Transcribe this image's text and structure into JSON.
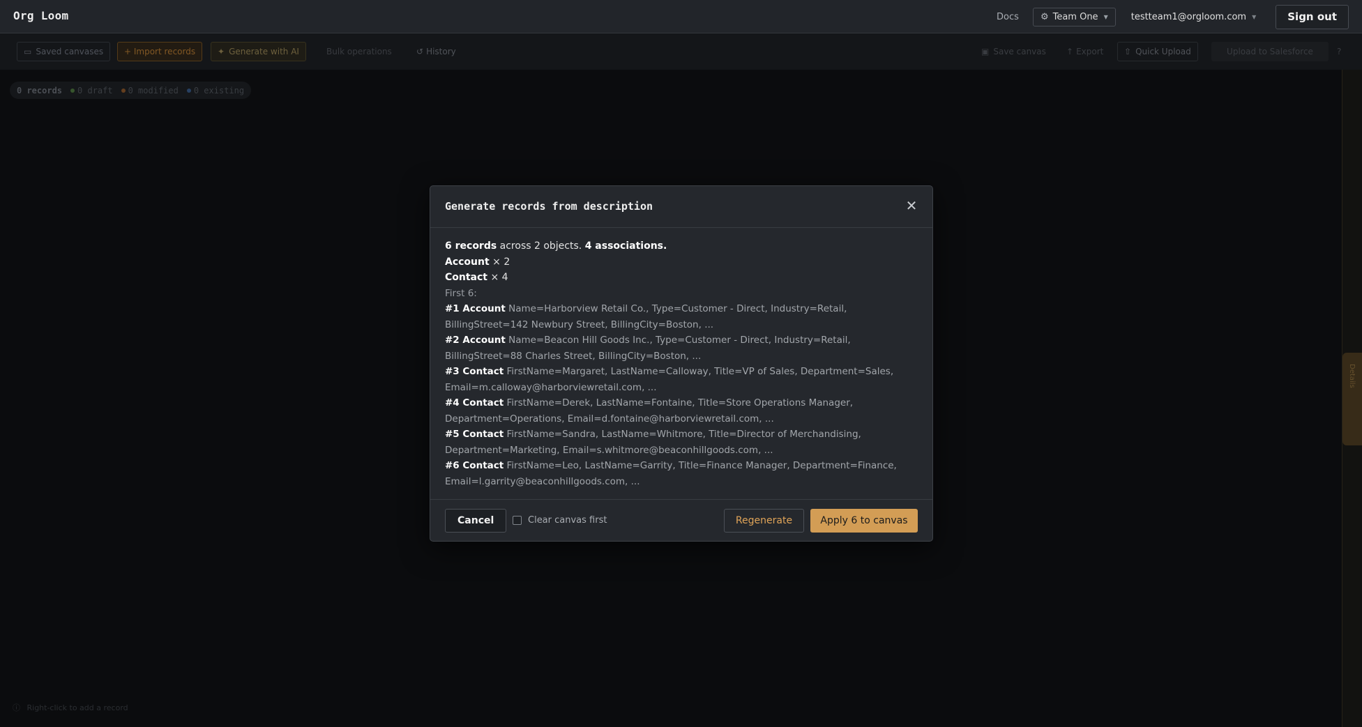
{
  "app": {
    "brand": "Org Loom"
  },
  "header": {
    "docs_label": "Docs",
    "team_label": "Team One",
    "user_email": "testteam1@orgloom.com",
    "signout_label": "Sign out"
  },
  "toolbar": {
    "saved_canvases": "Saved canvases",
    "import_records": "+ Import records",
    "generate_ai": "Generate with AI",
    "bulk_operations": "Bulk operations",
    "history": "History",
    "save_canvas": "Save canvas",
    "export": "Export",
    "quick_upload": "Quick Upload",
    "upload_salesforce": "Upload to Salesforce",
    "help": "?"
  },
  "stats": {
    "records": "0 records",
    "draft": "0 draft",
    "modified": "0 modified",
    "existing": "0 existing"
  },
  "canvas": {
    "hint": "Right-click to add a record",
    "side_tab": "Details"
  },
  "modal": {
    "title": "Generate records from description",
    "summary": {
      "records": "6 records",
      "across": "across 2 objects.",
      "associations": "4 associations."
    },
    "objects": [
      {
        "name": "Account",
        "count": "× 2"
      },
      {
        "name": "Contact",
        "count": "× 4"
      }
    ],
    "first_label": "First 6:",
    "records": [
      {
        "label": "#1 Account",
        "fields": "Name=Harborview Retail Co., Type=Customer - Direct, Industry=Retail, BillingStreet=142 Newbury Street, BillingCity=Boston, ..."
      },
      {
        "label": "#2 Account",
        "fields": "Name=Beacon Hill Goods Inc., Type=Customer - Direct, Industry=Retail, BillingStreet=88 Charles Street, BillingCity=Boston, ..."
      },
      {
        "label": "#3 Contact",
        "fields": "FirstName=Margaret, LastName=Calloway, Title=VP of Sales, Department=Sales, Email=m.calloway@harborviewretail.com, ..."
      },
      {
        "label": "#4 Contact",
        "fields": "FirstName=Derek, LastName=Fontaine, Title=Store Operations Manager, Department=Operations, Email=d.fontaine@harborviewretail.com, ..."
      },
      {
        "label": "#5 Contact",
        "fields": "FirstName=Sandra, LastName=Whitmore, Title=Director of Merchandising, Department=Marketing, Email=s.whitmore@beaconhillgoods.com, ..."
      },
      {
        "label": "#6 Contact",
        "fields": "FirstName=Leo, LastName=Garrity, Title=Finance Manager, Department=Finance, Email=l.garrity@beaconhillgoods.com, ..."
      }
    ],
    "cancel_label": "Cancel",
    "clear_label": "Clear canvas first",
    "clear_checked": false,
    "regenerate_label": "Regenerate",
    "apply_label": "Apply 6 to canvas"
  },
  "colors": {
    "accent": "#d39d55",
    "draft_dot": "#4c8a3e",
    "modified_dot": "#b06a2a",
    "existing_dot": "#3c6aa8"
  },
  "icons": {
    "team": "gear-icon",
    "close": "close-icon",
    "caret": "chevron-down-icon"
  }
}
